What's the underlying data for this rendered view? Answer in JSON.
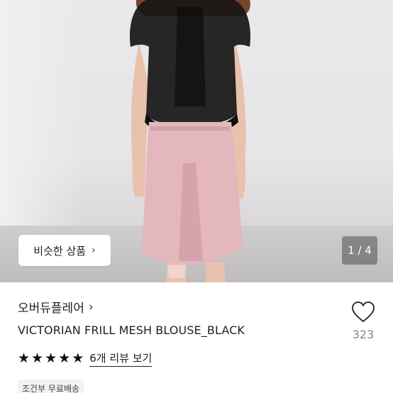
{
  "photo": {
    "similar_button_label": "비슷한 상품",
    "page_indicator": "1 / 4"
  },
  "product": {
    "shop_name": "오버듀플레어",
    "title": "VICTORIAN FRILL MESH BLOUSE_BLACK",
    "rating": 5,
    "review_link": "6개 리뷰 보기",
    "shipping_badge": "조건부 무료배송",
    "like_count": "323"
  },
  "icons": {
    "similar_chevron": "chevron-right-icon",
    "shop_chevron": "chevron-right-icon",
    "like": "heart-outline-icon",
    "star": "star-filled-icon"
  },
  "colors": {
    "blouse": "#161616",
    "skirt": "#e4b7bd",
    "text": "#222222",
    "muted": "#888888"
  }
}
